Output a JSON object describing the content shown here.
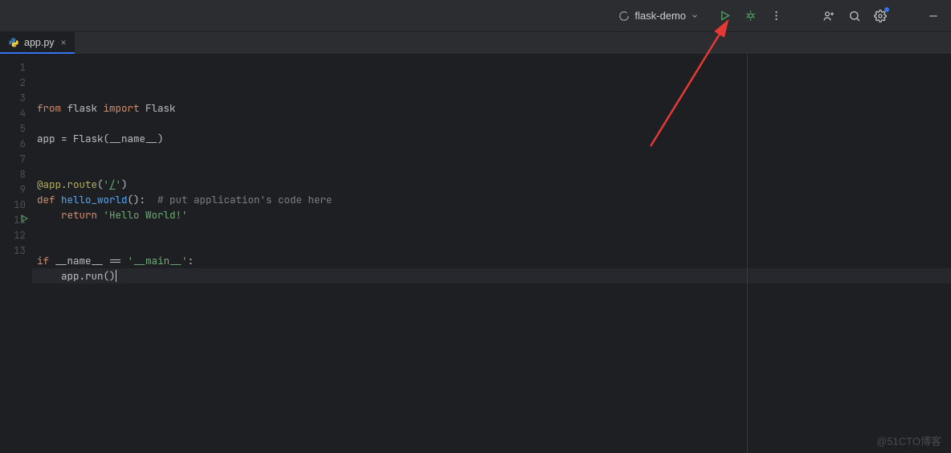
{
  "toolbar": {
    "run_config_label": "flask-demo"
  },
  "tab": {
    "filename": "app.py"
  },
  "code": {
    "lines": [
      {
        "n": 1,
        "tokens": [
          [
            "kw",
            "from"
          ],
          [
            "nm",
            " flask "
          ],
          [
            "kw",
            "import"
          ],
          [
            "nm",
            " Flask"
          ]
        ]
      },
      {
        "n": 2,
        "tokens": []
      },
      {
        "n": 3,
        "tokens": [
          [
            "nm",
            "app "
          ],
          [
            "op",
            "="
          ],
          [
            "nm",
            " Flask("
          ],
          [
            "nm",
            "__name__"
          ],
          [
            "nm",
            ")"
          ]
        ]
      },
      {
        "n": 4,
        "tokens": []
      },
      {
        "n": 5,
        "tokens": []
      },
      {
        "n": 6,
        "tokens": [
          [
            "dc",
            "@app.route"
          ],
          [
            "nm",
            "("
          ],
          [
            "st",
            "'"
          ],
          [
            "st ud",
            "/"
          ],
          [
            "st",
            "'"
          ],
          [
            "nm",
            ")"
          ]
        ]
      },
      {
        "n": 7,
        "tokens": [
          [
            "kw",
            "def "
          ],
          [
            "fn",
            "hello_world"
          ],
          [
            "nm",
            "():  "
          ],
          [
            "cm",
            "# put application's code here"
          ]
        ]
      },
      {
        "n": 8,
        "tokens": [
          [
            "nm",
            "    "
          ],
          [
            "kw",
            "return "
          ],
          [
            "st",
            "'Hello World!'"
          ]
        ]
      },
      {
        "n": 9,
        "tokens": []
      },
      {
        "n": 10,
        "tokens": []
      },
      {
        "n": 11,
        "tokens": [
          [
            "kw",
            "if"
          ],
          [
            "nm",
            " __name__ "
          ],
          [
            "op",
            "=="
          ],
          [
            "nm",
            " "
          ],
          [
            "st",
            "'__main__'"
          ],
          [
            "nm",
            ":"
          ]
        ],
        "run": true
      },
      {
        "n": 12,
        "tokens": [
          [
            "nm",
            "    app.run()"
          ]
        ],
        "current": true,
        "caret": true
      },
      {
        "n": 13,
        "tokens": []
      }
    ]
  },
  "watermark": "@51CTO博客"
}
